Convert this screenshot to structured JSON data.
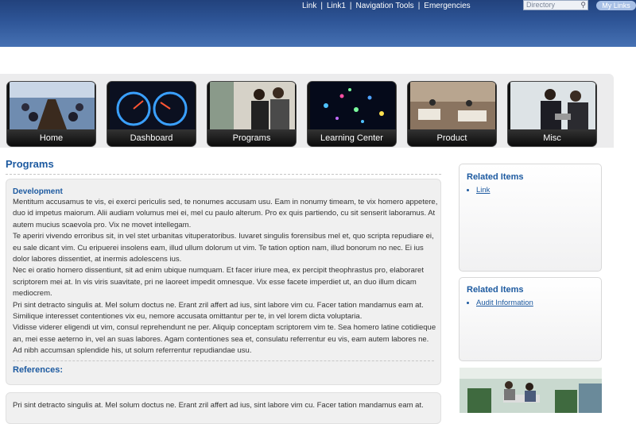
{
  "header": {
    "links": [
      {
        "label": "Link"
      },
      {
        "label": "Link1"
      },
      {
        "label": "Navigation Tools"
      },
      {
        "label": "Emergencies"
      }
    ],
    "separator": "|",
    "directory_placeholder": "Directory",
    "my_links": "My Links"
  },
  "tiles": [
    {
      "label": "Home",
      "icon": "boardroom-photo"
    },
    {
      "label": "Dashboard",
      "icon": "speedometer-photo"
    },
    {
      "label": "Programs",
      "icon": "tablet-users-photo"
    },
    {
      "label": "Learning Center",
      "icon": "fiber-optic-photo"
    },
    {
      "label": "Product",
      "icon": "lobby-photo"
    },
    {
      "label": "Misc",
      "icon": "car-laptop-photo"
    }
  ],
  "main": {
    "title": "Programs",
    "development_heading": "Development",
    "paragraphs": [
      "Mentitum accusamus te vis, ei exerci periculis sed, te nonumes accusam usu. Eam in nonumy timeam, te vix homero appetere, duo id impetus maiorum. Alii audiam volumus mei ei, mel cu paulo alterum. Pro ex quis partiendo, cu sit senserit laboramus. At autem mucius scaevola pro. Vix ne movet intellegam.",
      "Te aperiri vivendo erroribus sit, in vel stet urbanitas vituperatoribus. Iuvaret singulis forensibus mel et, quo scripta repudiare ei, eu sale dicant vim. Cu eripuerei insolens eam, illud ullum dolorum ut vim. Te tation option nam, illud bonorum no nec. Ei ius dolor labores dissentiet, at inermis adolescens ius.",
      "Nec ei oratio homero dissentiunt, sit ad enim ubique numquam. Et facer iriure mea, ex percipit theophrastus pro, elaboraret scriptorem mei at. In vis viris suavitate, pri ne laoreet impedit omnesque. Vix esse facete imperdiet ut, an duo illum dicam mediocrem.",
      "Pri sint detracto singulis at. Mel solum doctus ne. Erant zril affert ad ius, sint labore vim cu. Facer tation mandamus eam at. Similique interesset contentiones vix eu, nemore accusata omittantur per te, in vel lorem dicta voluptaria.",
      "Vidisse viderer eligendi ut vim, consul reprehendunt ne per. Aliquip conceptam scriptorem vim te. Sea homero latine cotidieque an, mei esse aeterno in, vel an suas labores. Agam contentiones sea et, consulatu referrentur eu vis, eam autem labores ne. Ad nibh accumsan splendide his, ut solum referrentur repudiandae usu."
    ],
    "references_heading": "References:",
    "second_box_text": "Pri sint detracto singulis at. Mel solum doctus ne. Erant zril affert ad ius, sint labore vim cu. Facer tation mandamus eam at."
  },
  "sidebar": {
    "related1": {
      "title": "Related Items",
      "items": [
        "Link"
      ]
    },
    "related2": {
      "title": "Related Items",
      "items": [
        "Audit Information"
      ]
    },
    "photo_icon": "lounge-photo"
  },
  "colors": {
    "header_top": "#22427c",
    "header_bottom": "#4671b3",
    "heading_blue": "#1d5aa0",
    "panel_gray": "#ececed"
  }
}
